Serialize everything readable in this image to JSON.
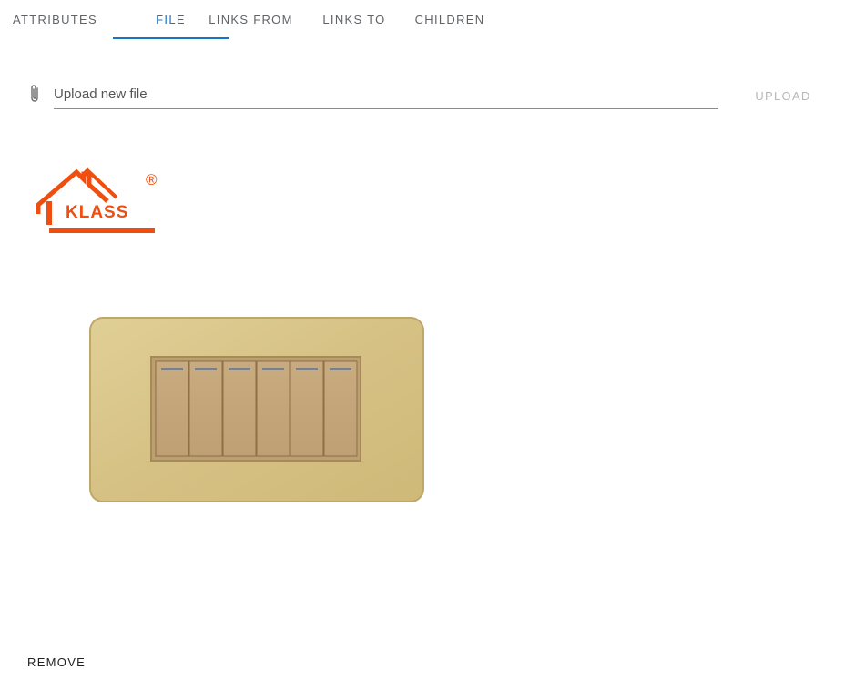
{
  "tabs": [
    {
      "label": "ATTRIBUTES",
      "active": false
    },
    {
      "label": "FILE",
      "active": true
    },
    {
      "label": "LINKS FROM",
      "active": false
    },
    {
      "label": "LINKS TO",
      "active": false
    },
    {
      "label": "CHILDREN",
      "active": false
    }
  ],
  "upload": {
    "placeholder": "Upload new file",
    "button_label": "UPLOAD",
    "icon": "paperclip-icon"
  },
  "preview": {
    "logo_text": "KLASS",
    "logo_mark": "®"
  },
  "actions": {
    "remove_label": "REMOVE"
  },
  "colors": {
    "accent": "#1a73c4",
    "logo": "#f04e0f",
    "plate": "#d8c48a",
    "rocker": "#c4a77c"
  }
}
